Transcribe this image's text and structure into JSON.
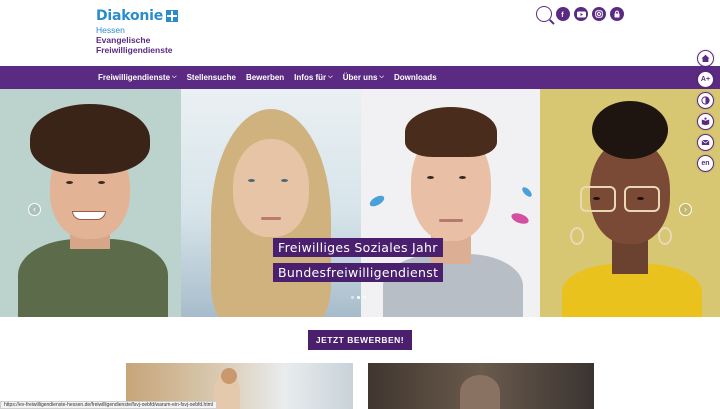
{
  "logo": {
    "name": "Diakonie",
    "region": "Hessen",
    "org_line1": "Evangelische",
    "org_line2": "Freiwilligendienste"
  },
  "header_icons": [
    "search-icon",
    "facebook-icon",
    "youtube-icon",
    "instagram-icon",
    "lock-icon"
  ],
  "nav": {
    "items": [
      {
        "label": "Freiwilligendienste",
        "dropdown": true
      },
      {
        "label": "Stellensuche",
        "dropdown": false
      },
      {
        "label": "Bewerben",
        "dropdown": false
      },
      {
        "label": "Infos für",
        "dropdown": true
      },
      {
        "label": "Über uns",
        "dropdown": true
      },
      {
        "label": "Downloads",
        "dropdown": false
      }
    ]
  },
  "hero": {
    "caption_line1": "Freiwilliges Soziales Jahr",
    "caption_line2": "Bundesfreiwilligendienst",
    "arrow_prev": "‹",
    "arrow_next": "›",
    "slides_total": 3,
    "slide_active": 2
  },
  "sidebar": {
    "buttons": [
      {
        "icon": "home-icon",
        "label": ""
      },
      {
        "icon": "font-size-icon",
        "label": "A+"
      },
      {
        "icon": "contrast-icon",
        "label": ""
      },
      {
        "icon": "easy-language-icon",
        "label": ""
      },
      {
        "icon": "mail-icon",
        "label": ""
      },
      {
        "icon": "language-icon",
        "label": "en"
      }
    ]
  },
  "cta": {
    "label": "JETZT BEWERBEN!"
  },
  "status_url": "https://ev-freiwilligendienste-hessen.de/freiwilligendienste/fsvj-oebfd/warum-ein-fsvj-oebfd.html",
  "colors": {
    "brand_purple": "#5b2a82",
    "cta_purple": "#4a1f6e",
    "logo_blue": "#2b8ccc"
  }
}
